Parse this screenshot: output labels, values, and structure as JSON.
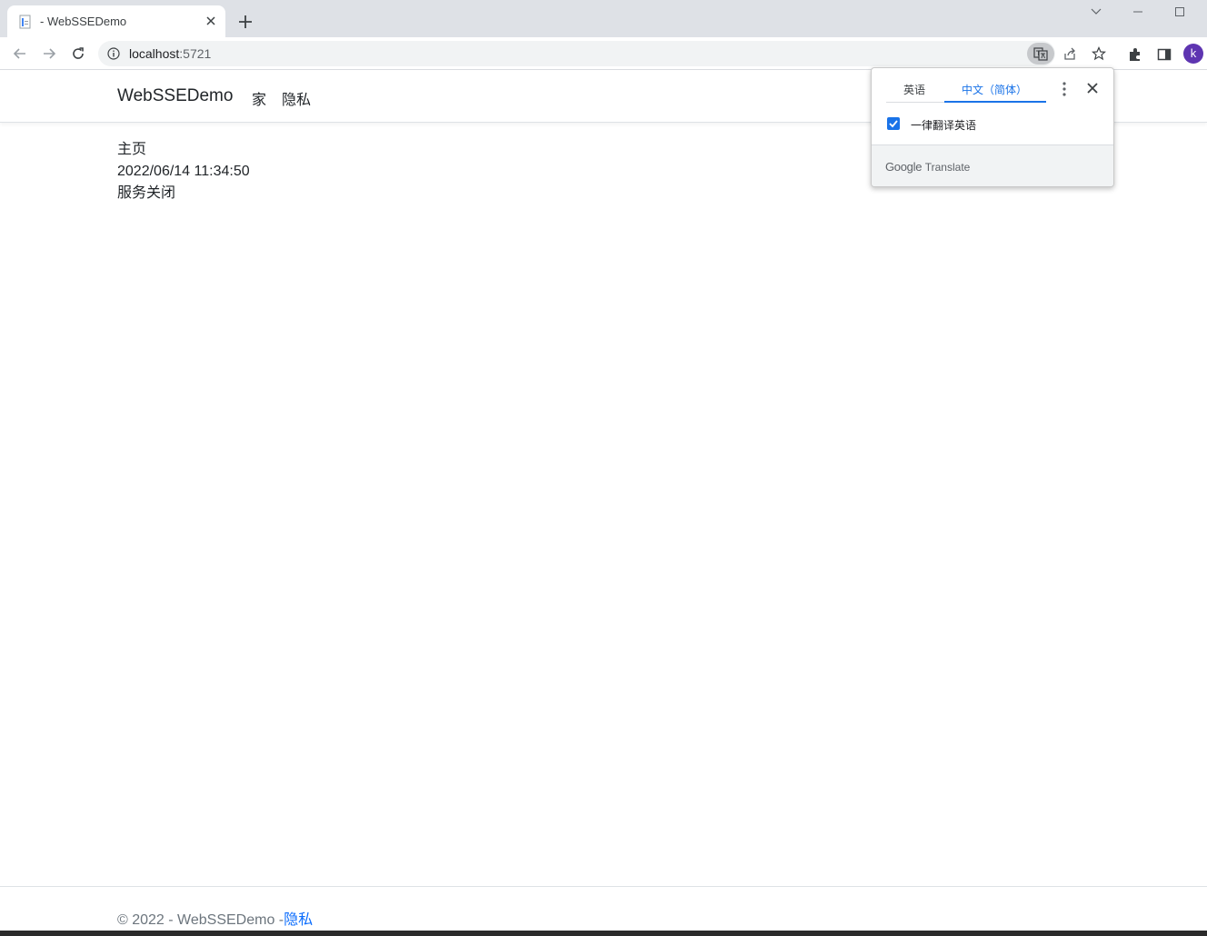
{
  "browser": {
    "tab_title": "- WebSSEDemo",
    "url_host": "localhost",
    "url_port": ":5721",
    "profile_initial": "k"
  },
  "site": {
    "brand": "WebSSEDemo",
    "nav": {
      "home": "家",
      "privacy": "隐私"
    }
  },
  "main": {
    "heading": "主页",
    "timestamp": "2022/06/14 11:34:50",
    "status": "服务关闭"
  },
  "footer": {
    "copyright": "© 2022 - WebSSEDemo -",
    "privacy_link": "隐私"
  },
  "translate_popup": {
    "source_tab": "英语",
    "target_tab": "中文（简体）",
    "always_translate_label": "一律翻译英语",
    "always_translate_checked": true,
    "brand_google": "Google",
    "brand_translate": "Translate"
  },
  "colors": {
    "accent": "#1a73e8",
    "link": "#0d6efd",
    "avatar": "#5e35b1"
  }
}
